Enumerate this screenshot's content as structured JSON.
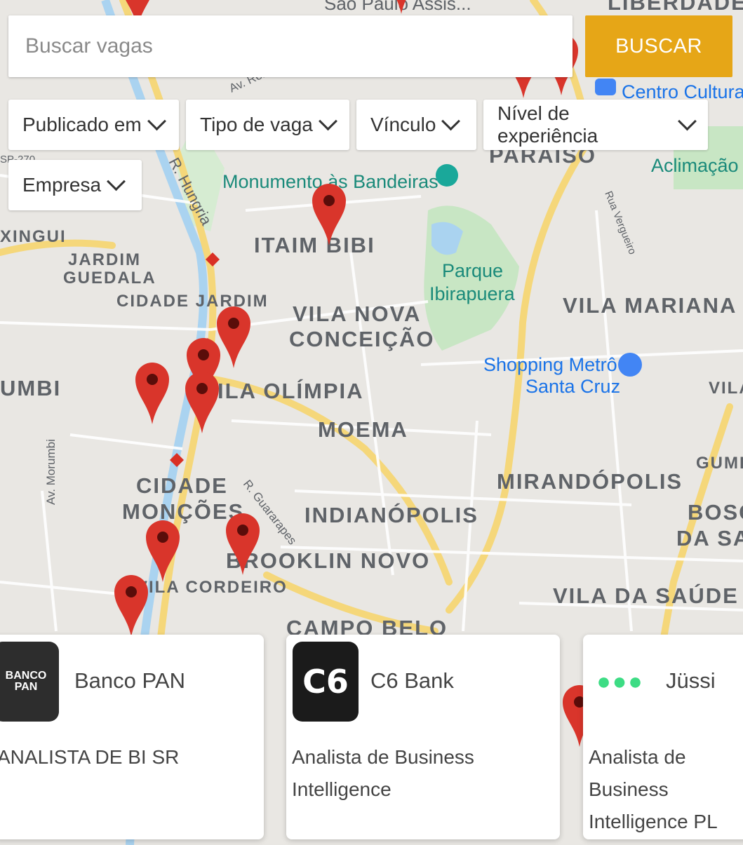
{
  "search": {
    "placeholder": "Buscar vagas",
    "button_label": "BUSCAR"
  },
  "filters": [
    "Publicado em",
    "Tipo de vaga",
    "Vínculo",
    "Nível de experiência",
    "Empresa"
  ],
  "map_labels": {
    "bairros": [
      "ITAIM BIBI",
      "JARDIM",
      "GUEDALA",
      "CIDADE JARDIM",
      "VILA NOVA",
      "CONCEIÇÃO",
      "VILA MARIANA",
      "ILA OLÍMPIA",
      "MOEMA",
      "MIRANDÓPOLIS",
      "CIDADE",
      "MONÇÕES",
      "INDIANÓPOLIS",
      "BROOKLIN NOVO",
      "VILA CORDEIRO",
      "VILA DA SAÚDE",
      "CAMPO BELO",
      "PARAÍSO",
      "LIBERDADE",
      "XINGUI",
      "UMBI",
      "BOSC",
      "DA SA",
      "GUME",
      "VILA"
    ],
    "places": [
      "Monumento às Bandeiras",
      "Parque",
      "Ibirapuera",
      "Shopping Metrô",
      "Santa Cruz",
      "Centro Cultural",
      "Aclimação",
      "São Paulo Assis..."
    ],
    "streets": [
      "R. Hungria",
      "Av. Morumbi",
      "R. Guararapes",
      "Rua Vergueiro",
      "Av. Rebouças",
      "SP-270"
    ]
  },
  "cards": [
    {
      "logo_text": "BANCO PAN",
      "company": "Banco PAN",
      "title": "ANALISTA DE BI SR"
    },
    {
      "logo_text": "C6",
      "company": "C6 Bank",
      "title": "Analista de Business Intelligence"
    },
    {
      "logo_text": "●●●",
      "company": "Jüssi",
      "title": "Analista de Business Intelligence PL"
    }
  ],
  "colors": {
    "accent": "#E6A617",
    "pin": "#D9352B",
    "park": "#C7E6C4",
    "road": "#F9E49B",
    "water": "#AAD3F0"
  }
}
